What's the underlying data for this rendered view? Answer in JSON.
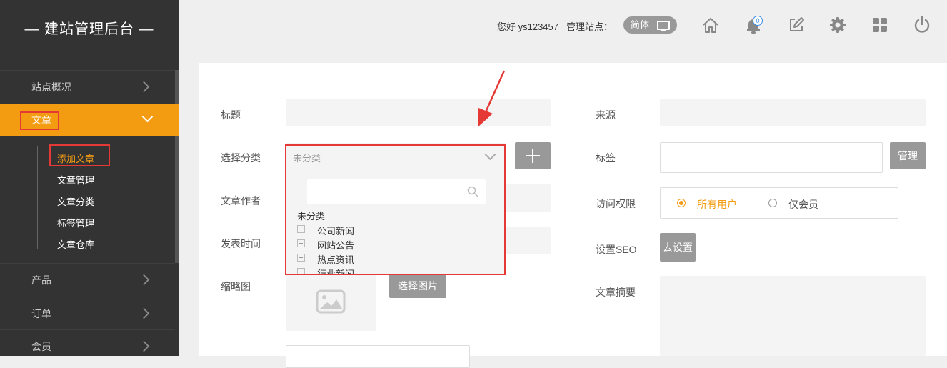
{
  "sidebar": {
    "logo": "— 建站管理后台 —",
    "nav": {
      "overview": "站点概况",
      "article": "文章",
      "product": "产品",
      "order": "订单",
      "member": "会员"
    },
    "article_sub": [
      "添加文章",
      "文章管理",
      "文章分类",
      "标签管理",
      "文章仓库"
    ]
  },
  "topbar": {
    "greeting": "您好 ys123457",
    "site_label": "管理站点：",
    "lang": "简体",
    "notification_count": "0",
    "icons": [
      "home-icon",
      "bell-icon",
      "edit-icon",
      "gear-icon",
      "apps-icon",
      "power-icon"
    ]
  },
  "form": {
    "title_label": "标题",
    "category_label": "选择分类",
    "category_value": "未分类",
    "author_label": "文章作者",
    "publish_label": "发表时间",
    "thumb_label": "缩略图",
    "choose_image": "选择图片",
    "source_label": "来源",
    "tags_label": "标签",
    "manage_btn": "管理",
    "access_label": "访问权限",
    "access_options": [
      "所有用户",
      "仅会员"
    ],
    "access_selected": "所有用户",
    "seo_label": "设置SEO",
    "seo_btn": "去设置",
    "summary_label": "文章摘要"
  },
  "dropdown": {
    "root": "未分类",
    "nodes": [
      "公司新闻",
      "网站公告",
      "热点资讯",
      "行业新闻"
    ]
  },
  "colors": {
    "accent": "#f39c12",
    "sidebar": "#333333",
    "highlight": "#e53935"
  }
}
